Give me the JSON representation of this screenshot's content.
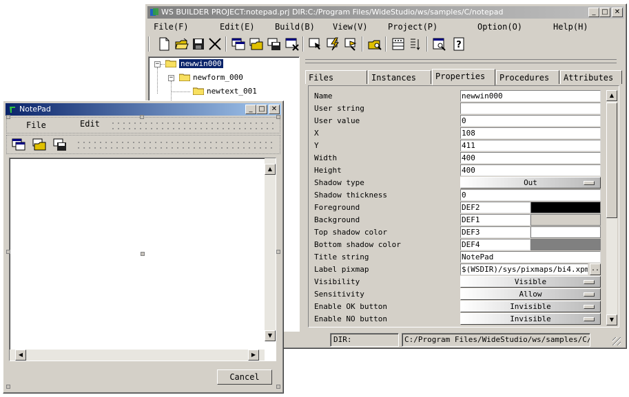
{
  "builder": {
    "title": "WS BUILDER PROJECT:notepad.prj DIR:C:/Program Files/WideStudio/ws/samples/C/notepad",
    "menu": [
      "File(F)",
      "Edit(E)",
      "Build(B)",
      "View(V)",
      "Project(P)",
      "Option(O)",
      "Help(H)"
    ],
    "toolbar_icons": [
      "new-file-icon",
      "open-folder-icon",
      "save-icon",
      "cut-icon",
      "new-window-icon",
      "open-window-icon",
      "save-window-icon",
      "close-window-icon",
      "select-icon",
      "build-icon",
      "run-icon",
      "search-folder-icon",
      "grid-icon",
      "align-icon",
      "preview-icon",
      "help-icon"
    ],
    "tree": [
      {
        "label": "newwin000",
        "selected": true
      },
      {
        "label": "newform_000",
        "selected": false
      },
      {
        "label": "newtext_001",
        "selected": false
      }
    ],
    "tabs": [
      "Files",
      "Instances",
      "Properties",
      "Procedures",
      "Attributes"
    ],
    "active_tab": "Properties",
    "properties": [
      {
        "label": "Name",
        "value": "newwin000",
        "kind": "text"
      },
      {
        "label": "User string",
        "value": "",
        "kind": "text"
      },
      {
        "label": "User value",
        "value": "0",
        "kind": "text"
      },
      {
        "label": "X",
        "value": "108",
        "kind": "text"
      },
      {
        "label": "Y",
        "value": "411",
        "kind": "text"
      },
      {
        "label": "Width",
        "value": "400",
        "kind": "text"
      },
      {
        "label": "Height",
        "value": "400",
        "kind": "text"
      },
      {
        "label": "Shadow type",
        "value": "Out",
        "kind": "option"
      },
      {
        "label": "Shadow thickness",
        "value": "0",
        "kind": "text"
      },
      {
        "label": "Foreground",
        "value": "DEF2",
        "kind": "color",
        "color": "#000000"
      },
      {
        "label": "Background",
        "value": "DEF1",
        "kind": "color",
        "color": "#d4d0c8"
      },
      {
        "label": "Top shadow color",
        "value": "DEF3",
        "kind": "color",
        "color": "#ffffff"
      },
      {
        "label": "Bottom shadow color",
        "value": "DEF4",
        "kind": "color",
        "color": "#808080"
      },
      {
        "label": "Title string",
        "value": "NotePad",
        "kind": "text"
      },
      {
        "label": "Label pixmap",
        "value": "$(WSDIR)/sys/pixmaps/bi4.xpm",
        "kind": "file"
      },
      {
        "label": "Visibility",
        "value": "Visible",
        "kind": "option"
      },
      {
        "label": "Sensitivity",
        "value": "Allow",
        "kind": "option"
      },
      {
        "label": "Enable OK button",
        "value": "Invisible",
        "kind": "option"
      },
      {
        "label": "Enable NO button",
        "value": "Invisible",
        "kind": "option"
      }
    ],
    "browse_label": "..",
    "status": {
      "dir_label": "DIR:",
      "dir_value": "C:/Program Files/WideStudio/ws/samples/C/note"
    }
  },
  "notepad": {
    "title": "NotePad",
    "menu": [
      "File",
      "Edit"
    ],
    "toolbar_icons": [
      "new-window-icon",
      "open-window-icon",
      "save-window-icon"
    ],
    "cancel_label": "Cancel"
  },
  "colors": {
    "active_title": "#0a246a",
    "inactive_title": "#808080",
    "selection": "#0a246a"
  }
}
